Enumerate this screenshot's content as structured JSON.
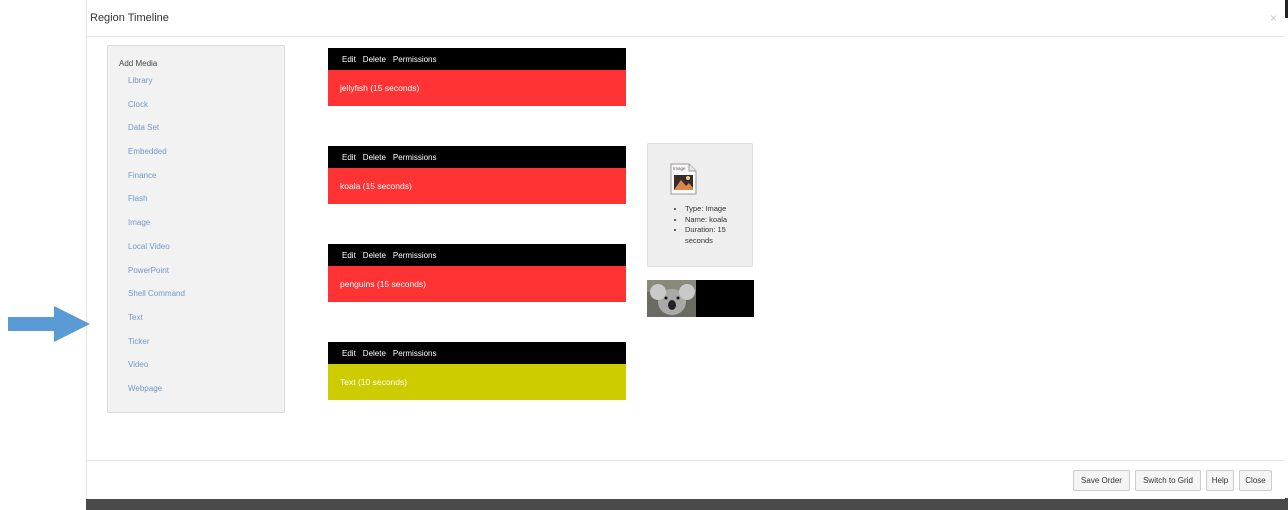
{
  "modal": {
    "title": "Region Timeline",
    "close": "×"
  },
  "sidebar": {
    "heading": "Add Media",
    "items": [
      "Library",
      "Clock",
      "Data Set",
      "Embedded",
      "Finance",
      "Flash",
      "Image",
      "Local Video",
      "PowerPoint",
      "Shell Command",
      "Text",
      "Ticker",
      "Video",
      "Webpage"
    ]
  },
  "toolbar_labels": {
    "edit": "Edit",
    "delete": "Delete",
    "permissions": "Permissions"
  },
  "media": [
    {
      "label": "jellyfish (15 seconds)",
      "color": "#ff3333"
    },
    {
      "label": "koala (15 seconds)",
      "color": "#ff3333"
    },
    {
      "label": "penguins (15 seconds)",
      "color": "#ff3333"
    },
    {
      "label": "Text (10 seconds)",
      "color": "#cccc00"
    }
  ],
  "preview": {
    "icon": "image-file-icon",
    "icon_label": "Image",
    "type": "Type: Image",
    "name": "Name: koala",
    "duration": "Duration: 15 seconds"
  },
  "footer": {
    "save_order": "Save Order",
    "switch_grid": "Switch to Grid",
    "help": "Help",
    "close": "Close"
  },
  "colors": {
    "accent_link": "#6f9ac7",
    "arrow": "#5b9bd5"
  }
}
